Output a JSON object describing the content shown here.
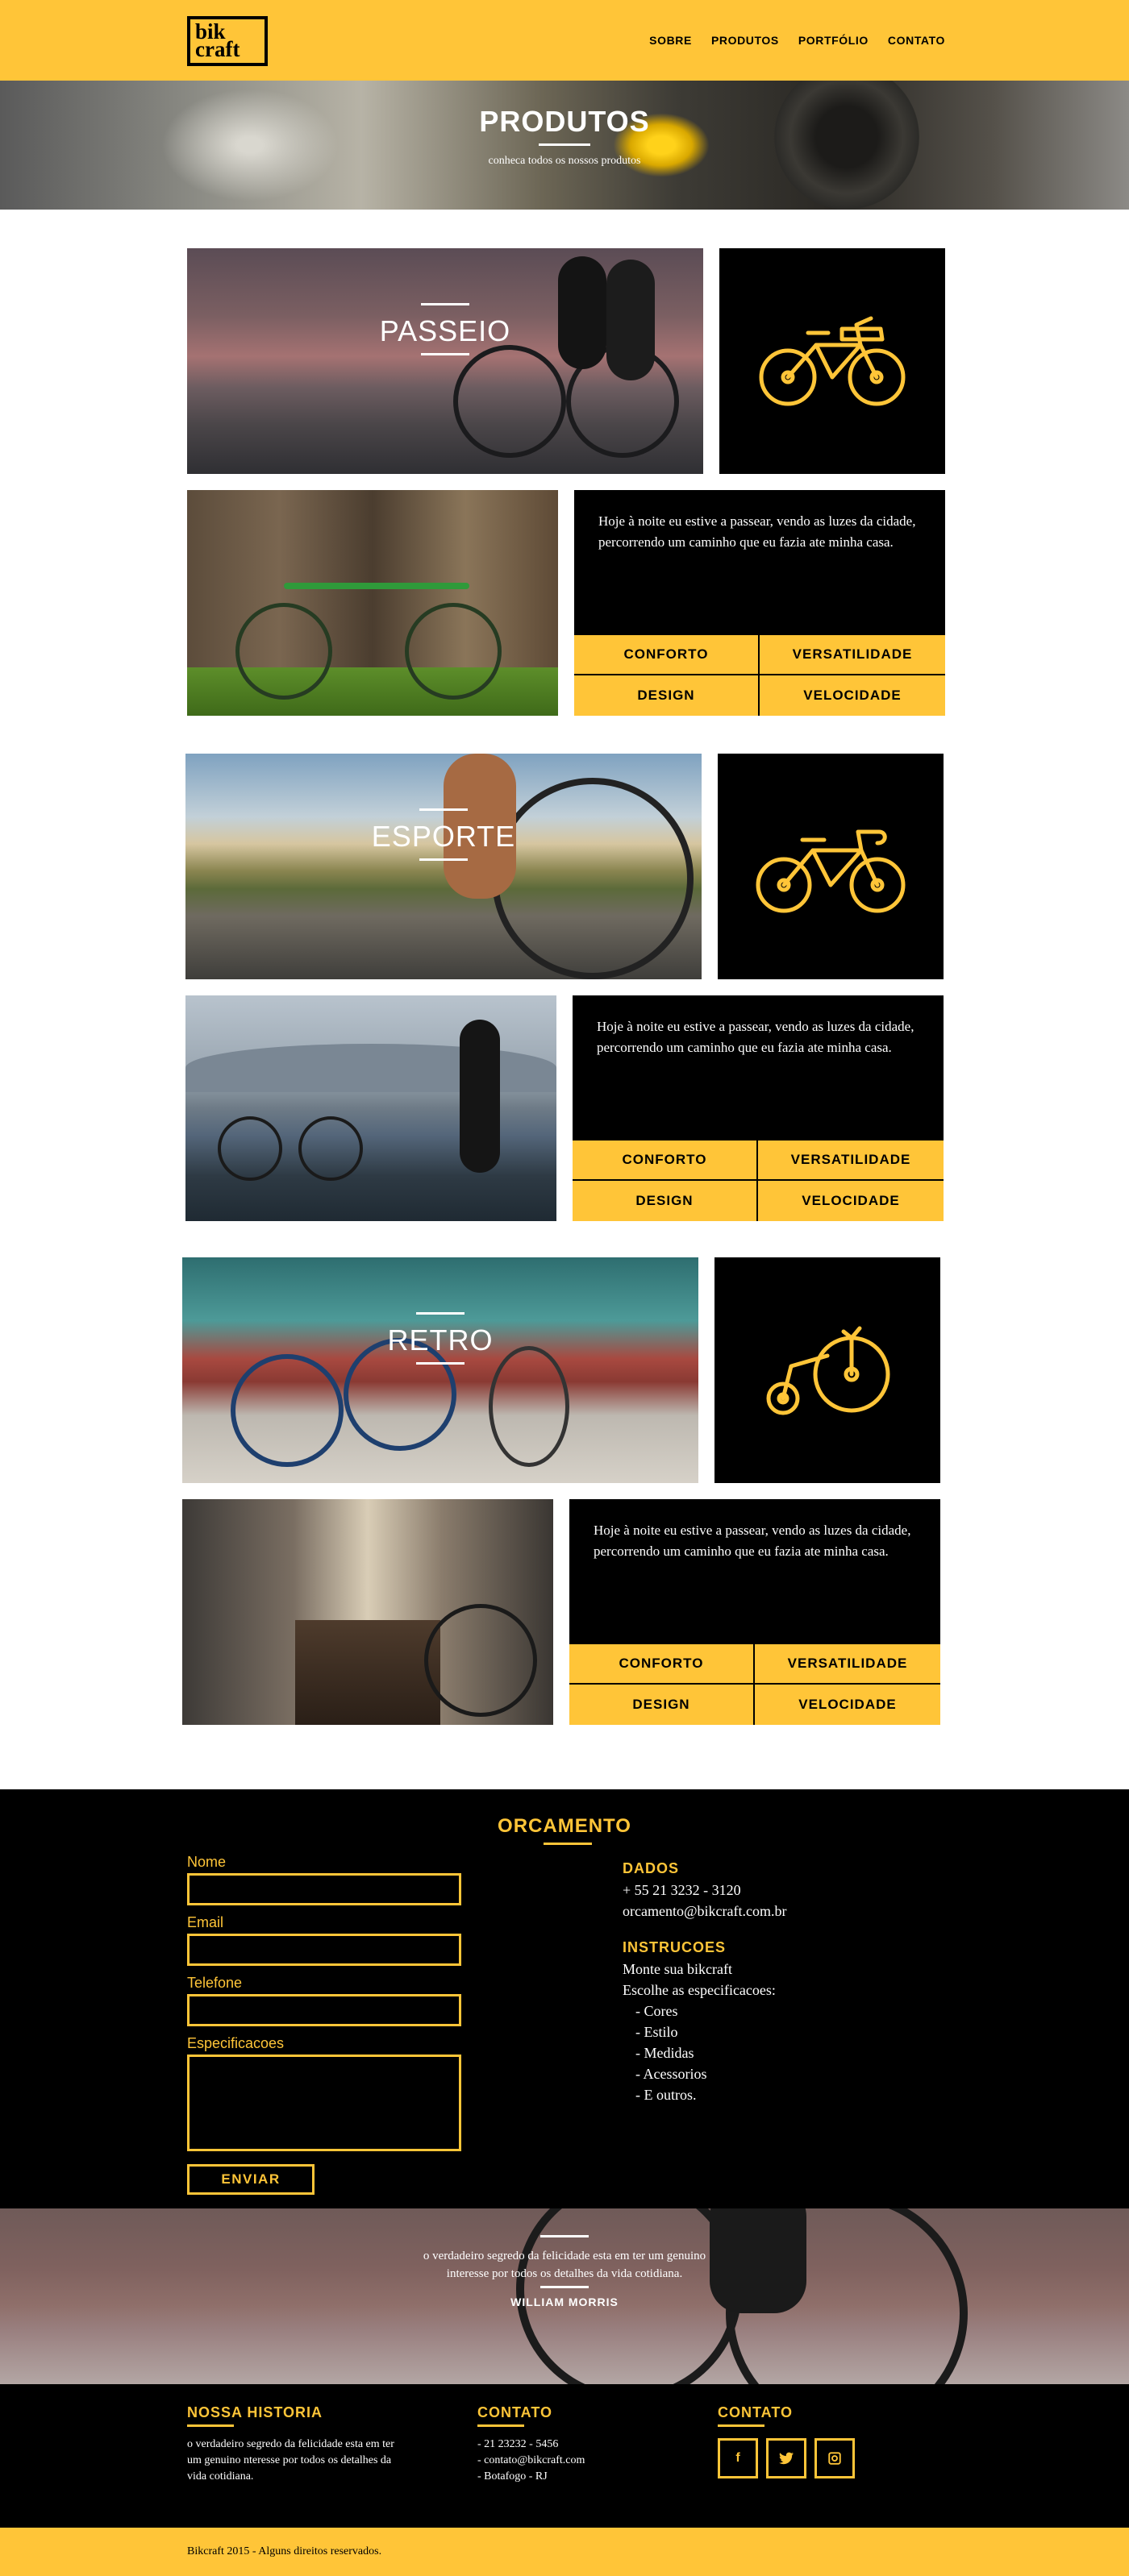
{
  "header": {
    "logo_line1": "bik",
    "logo_line2": "craft",
    "nav": [
      "SOBRE",
      "PRODUTOS",
      "PORTFÓLIO",
      "CONTATO"
    ]
  },
  "hero": {
    "title": "PRODUTOS",
    "subtitle": "conheca todos os nossos produtos"
  },
  "products": [
    {
      "title": "PASSEIO",
      "icon": "city-bike-icon",
      "description": "Hoje à noite eu estive a passear, vendo as luzes da cidade, percorrendo um caminho que eu fazia ate minha casa.",
      "features": [
        "CONFORTO",
        "VERSATILIDADE",
        "DESIGN",
        "VELOCIDADE"
      ]
    },
    {
      "title": "ESPORTE",
      "icon": "sport-bike-icon",
      "description": "Hoje à noite eu estive a passear, vendo as luzes da cidade, percorrendo um caminho que eu fazia ate minha casa.",
      "features": [
        "CONFORTO",
        "VERSATILIDADE",
        "DESIGN",
        "VELOCIDADE"
      ]
    },
    {
      "title": "RETRO",
      "icon": "penny-farthing-icon",
      "description": "Hoje à noite eu estive a passear, vendo as luzes da cidade, percorrendo um caminho que eu fazia ate minha casa.",
      "features": [
        "CONFORTO",
        "VERSATILIDADE",
        "DESIGN",
        "VELOCIDADE"
      ]
    }
  ],
  "orcamento": {
    "title": "ORCAMENTO",
    "fields": {
      "nome": "Nome",
      "email": "Email",
      "telefone": "Telefone",
      "especificacoes": "Especificacoes"
    },
    "submit": "ENVIAR",
    "dados_title": "DADOS",
    "phone": "+ 55 21 3232 - 3120",
    "email": "orcamento@bikcraft.com.br",
    "instrucoes_title": "INSTRUCOES",
    "instrucoes_line1": "Monte sua bikcraft",
    "instrucoes_line2": "Escolhe as especificacoes:",
    "instrucoes_items": [
      "- Cores",
      "- Estilo",
      "- Medidas",
      "- Acessorios",
      "- E outros."
    ]
  },
  "quote": {
    "text": "o verdadeiro segredo da felicidade esta em ter um genuino interesse por todos os detalhes da vida cotidiana.",
    "author": "WILLIAM MORRIS"
  },
  "footer": {
    "historia_title": "NOSSA HISTORIA",
    "historia_text": "o verdadeiro segredo da felicidade esta em ter um genuino nteresse por todos os detalhes da vida cotidiana.",
    "contato_title": "CONTATO",
    "contato_items": [
      "- 21 23232 - 5456",
      "- contato@bikcraft.com",
      "- Botafogo - RJ"
    ],
    "social_title": "CONTATO",
    "social_icons": [
      "facebook-icon",
      "twitter-icon",
      "instagram-icon"
    ],
    "copyright": "Bikcraft 2015 - Alguns direitos reservados."
  },
  "colors": {
    "accent": "#ffc538",
    "dark": "#000000",
    "light": "#ffffff"
  }
}
